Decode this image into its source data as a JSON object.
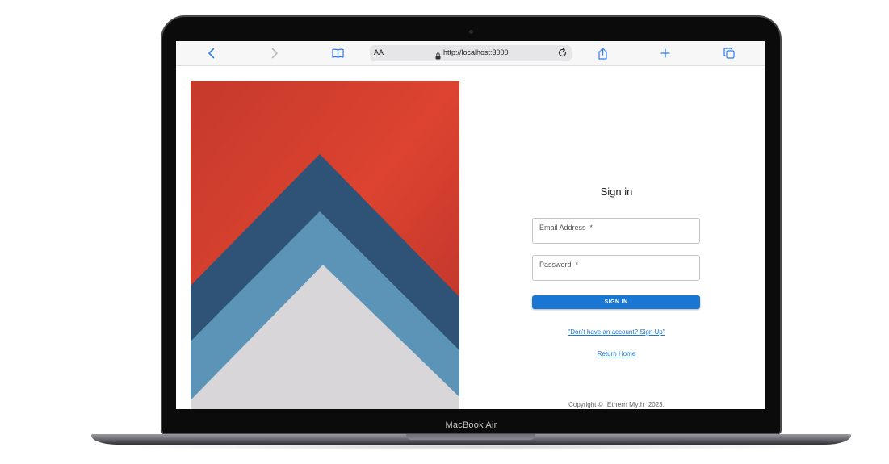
{
  "device": {
    "label": "MacBook Air"
  },
  "browser": {
    "text_size_label": "AA",
    "url": "http://localhost:3000"
  },
  "signin": {
    "title": "Sign in",
    "email_label": "Email Address",
    "password_label": "Password",
    "required_mark": "*",
    "button_label": "SIGN IN",
    "signup_link": "\"Don't have an account? Sign Up\"",
    "home_link": "Return Home"
  },
  "footer": {
    "copyright_prefix": "Copyright ©",
    "brand": "Ethern Myth",
    "year": "2023."
  },
  "colors": {
    "primary": "#1976d2",
    "art_red": "#d9412c",
    "art_navy": "#2f5376",
    "art_blue": "#5b94b6",
    "art_paper": "#d8d6d8"
  }
}
